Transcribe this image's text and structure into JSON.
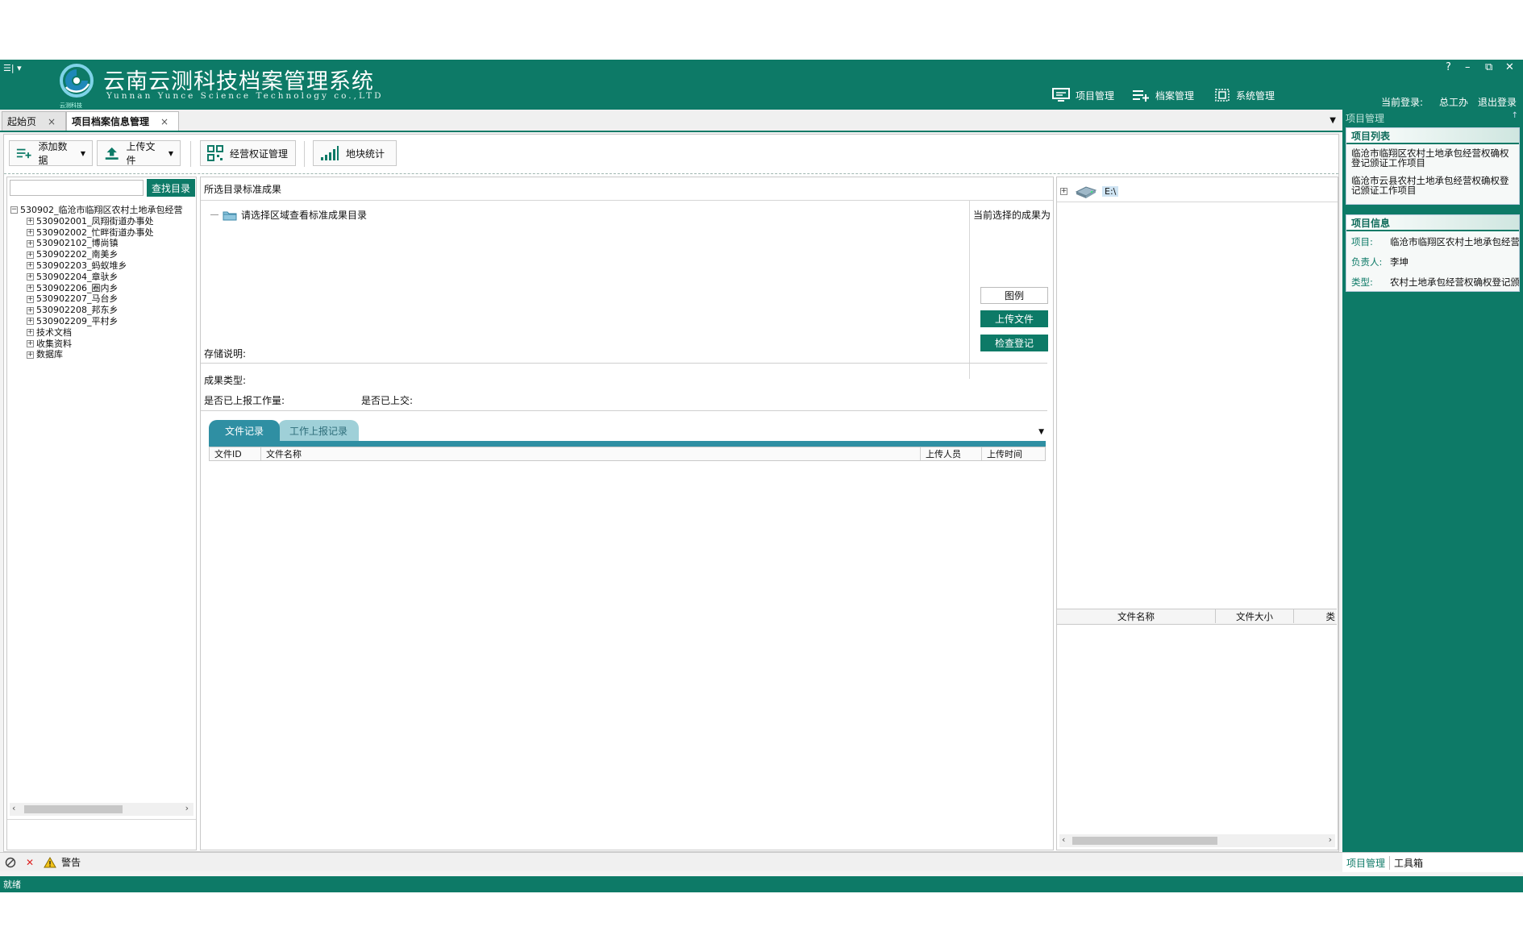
{
  "window": {
    "title": "云南云测科技档案管理系统",
    "subtitle": "Yunnan Yunce Science Technology co.,LTD",
    "logo_text": "云测科技",
    "quick_access": "☰| ▾",
    "controls": {
      "help": "?",
      "minimize": "–",
      "restore": "⧉",
      "close": "✕"
    }
  },
  "nav_menu": [
    {
      "label": "项目管理",
      "icon": "monitor-icon"
    },
    {
      "label": "档案管理",
      "icon": "list-add-icon"
    },
    {
      "label": "系统管理",
      "icon": "system-grid-icon"
    }
  ],
  "login": {
    "label": "当前登录:",
    "user": "总工办",
    "logout": "退出登录"
  },
  "doc_tabs": [
    {
      "label": "起始页",
      "close": "×",
      "active": false
    },
    {
      "label": "项目档案信息管理",
      "close": "×",
      "active": true
    }
  ],
  "toolbar": {
    "add_data": "添加数据",
    "upload_file": "上传文件",
    "right_cert": "经营权证管理",
    "parcel_stats": "地块统计"
  },
  "left_panel": {
    "search_placeholder": "",
    "search_button": "查找目录",
    "tree_root": "530902_临沧市临翔区农村土地承包经营",
    "tree_children": [
      "530902001_凤翔街道办事处",
      "530902002_忙畔街道办事处",
      "530902102_博尚镇",
      "530902202_南美乡",
      "530902203_蚂蚁堆乡",
      "530902204_章驮乡",
      "530902206_圈内乡",
      "530902207_马台乡",
      "530902208_邦东乡",
      "530902209_平村乡",
      "技术文档",
      "收集资料",
      "数据库"
    ]
  },
  "middle_panel": {
    "header": "所选目录标准成果",
    "folder_hint": "请选择区域查看标准成果目录",
    "current_label": "当前选择的成果为",
    "legend_button": "图例",
    "upload_button": "上传文件",
    "check_button": "检查登记",
    "storage_note": "存储说明:",
    "result_type": "成果类型:",
    "reported_workload": "是否已上报工作量:",
    "submitted": "是否已上交:",
    "subtabs": [
      "文件记录",
      "工作上报记录"
    ],
    "grid_columns": [
      "文件ID",
      "文件名称",
      "上传人员",
      "上传时间"
    ]
  },
  "right_panel": {
    "drive": "E:\\",
    "file_columns": [
      "文件名称",
      "文件大小",
      "类"
    ]
  },
  "project_panel": {
    "title": "项目管理",
    "pin": "↑",
    "list_header": "项目列表",
    "projects": [
      "临沧市临翔区农村土地承包经营权确权登记颁证工作项目",
      "临沧市云县农村土地承包经营权确权登记颁证工作项目"
    ],
    "info_header": "项目信息",
    "info": [
      {
        "key": "项目:",
        "value": "临沧市临翔区农村土地承包经营权确权登记颁证工作项目"
      },
      {
        "key": "负责人:",
        "value": "李坤"
      },
      {
        "key": "类型:",
        "value": "农村土地承包经营权确权登记颁证"
      }
    ],
    "bottom_tabs": [
      "项目管理",
      "工具箱"
    ]
  },
  "bottom_bar": {
    "warning_label": "警告"
  },
  "status": {
    "text": "就绪"
  },
  "colors": {
    "brand": "#0d7a67",
    "tab_active": "#2f8fa3",
    "tab_inactive": "#9fd0d8"
  }
}
